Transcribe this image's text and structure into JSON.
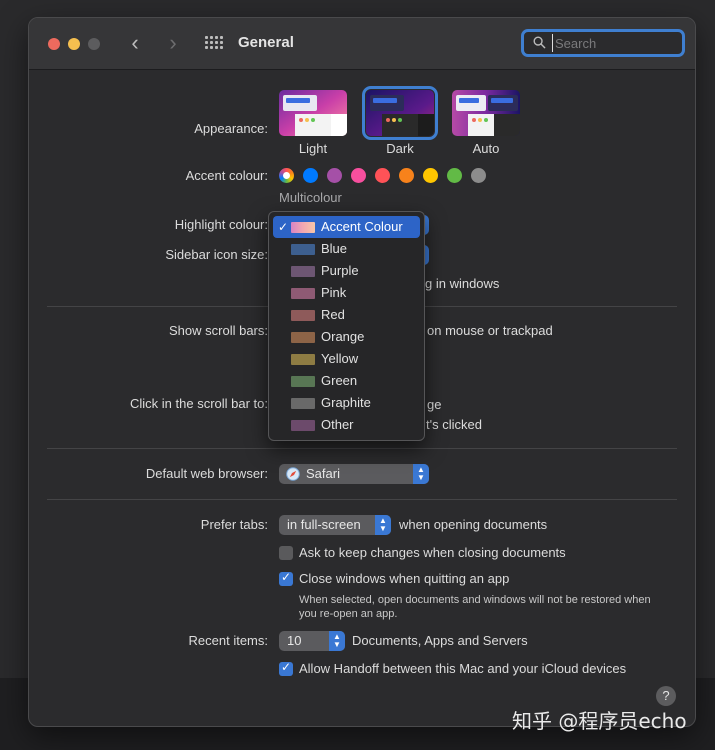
{
  "window": {
    "title": "General"
  },
  "search": {
    "placeholder": "Search"
  },
  "appearance": {
    "label": "Appearance:",
    "options": [
      "Light",
      "Dark",
      "Auto"
    ],
    "selected": "Dark"
  },
  "accent": {
    "label": "Accent colour:",
    "selected_name": "Multicolour",
    "colors": [
      "#007aff",
      "#a550a7",
      "#f74f9e",
      "#ff5257",
      "#f7821b",
      "#ffc600",
      "#62ba46",
      "#8c8c8c"
    ]
  },
  "highlight": {
    "label": "Highlight colour:"
  },
  "sidebar_icon": {
    "label": "Sidebar icon size:",
    "trailing": "g in windows"
  },
  "scroll": {
    "label": "Show scroll bars:",
    "trailing": "on mouse or trackpad"
  },
  "click_scroll": {
    "label": "Click in the scroll bar to:",
    "trailing1": "ge",
    "trailing2": "t's clicked"
  },
  "dropdown": {
    "items": [
      {
        "label": "Accent Colour",
        "swatch": "gradient",
        "checked": true
      },
      {
        "label": "Blue",
        "swatch": "#3d5f8f"
      },
      {
        "label": "Purple",
        "swatch": "#6d5673"
      },
      {
        "label": "Pink",
        "swatch": "#8e5a74"
      },
      {
        "label": "Red",
        "swatch": "#8e5a5a"
      },
      {
        "label": "Orange",
        "swatch": "#8d6447"
      },
      {
        "label": "Yellow",
        "swatch": "#8e7c43"
      },
      {
        "label": "Green",
        "swatch": "#587654"
      },
      {
        "label": "Graphite",
        "swatch": "#696969"
      },
      {
        "label": "Other",
        "swatch": "#6c4a6b"
      }
    ]
  },
  "browser": {
    "label": "Default web browser:",
    "value": "Safari"
  },
  "tabs": {
    "label": "Prefer tabs:",
    "value": "in full-screen",
    "trailing": "when opening documents"
  },
  "ask_keep": {
    "label": "Ask to keep changes when closing documents",
    "checked": false
  },
  "close_windows": {
    "label": "Close windows when quitting an app",
    "checked": true,
    "note": "When selected, open documents and windows will not be restored when you re-open an app."
  },
  "recent": {
    "label": "Recent items:",
    "value": "10",
    "trailing": "Documents, Apps and Servers"
  },
  "handoff": {
    "label": "Allow Handoff between this Mac and your iCloud devices",
    "checked": true
  },
  "help": {
    "label": "?"
  },
  "watermark": {
    "text": "知乎 @程序员echo"
  }
}
